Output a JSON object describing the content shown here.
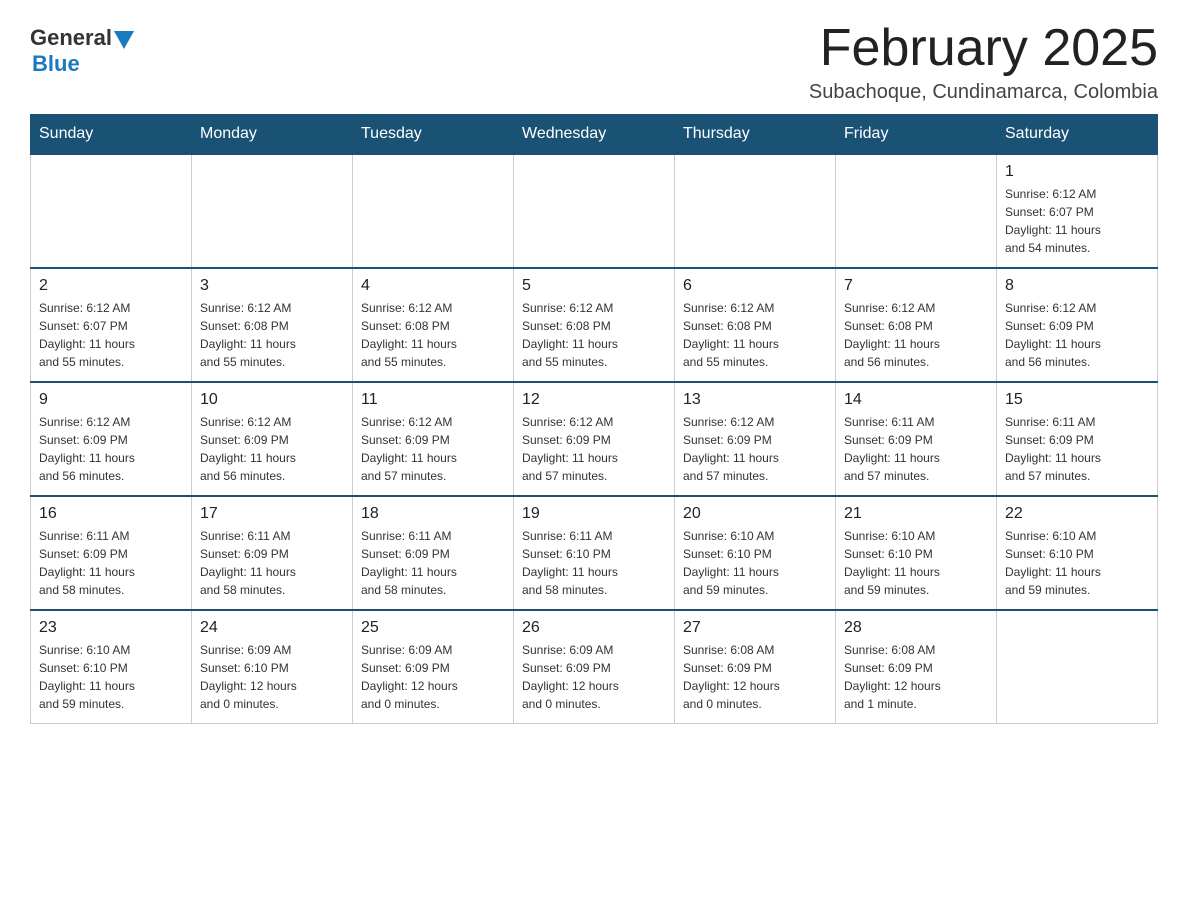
{
  "header": {
    "logo": {
      "general": "General",
      "blue": "Blue"
    },
    "title": "February 2025",
    "subtitle": "Subachoque, Cundinamarca, Colombia"
  },
  "days_of_week": [
    "Sunday",
    "Monday",
    "Tuesday",
    "Wednesday",
    "Thursday",
    "Friday",
    "Saturday"
  ],
  "weeks": [
    {
      "days": [
        {
          "number": "",
          "info": "",
          "empty": true
        },
        {
          "number": "",
          "info": "",
          "empty": true
        },
        {
          "number": "",
          "info": "",
          "empty": true
        },
        {
          "number": "",
          "info": "",
          "empty": true
        },
        {
          "number": "",
          "info": "",
          "empty": true
        },
        {
          "number": "",
          "info": "",
          "empty": true
        },
        {
          "number": "1",
          "info": "Sunrise: 6:12 AM\nSunset: 6:07 PM\nDaylight: 11 hours\nand 54 minutes."
        }
      ]
    },
    {
      "days": [
        {
          "number": "2",
          "info": "Sunrise: 6:12 AM\nSunset: 6:07 PM\nDaylight: 11 hours\nand 55 minutes."
        },
        {
          "number": "3",
          "info": "Sunrise: 6:12 AM\nSunset: 6:08 PM\nDaylight: 11 hours\nand 55 minutes."
        },
        {
          "number": "4",
          "info": "Sunrise: 6:12 AM\nSunset: 6:08 PM\nDaylight: 11 hours\nand 55 minutes."
        },
        {
          "number": "5",
          "info": "Sunrise: 6:12 AM\nSunset: 6:08 PM\nDaylight: 11 hours\nand 55 minutes."
        },
        {
          "number": "6",
          "info": "Sunrise: 6:12 AM\nSunset: 6:08 PM\nDaylight: 11 hours\nand 55 minutes."
        },
        {
          "number": "7",
          "info": "Sunrise: 6:12 AM\nSunset: 6:08 PM\nDaylight: 11 hours\nand 56 minutes."
        },
        {
          "number": "8",
          "info": "Sunrise: 6:12 AM\nSunset: 6:09 PM\nDaylight: 11 hours\nand 56 minutes."
        }
      ]
    },
    {
      "days": [
        {
          "number": "9",
          "info": "Sunrise: 6:12 AM\nSunset: 6:09 PM\nDaylight: 11 hours\nand 56 minutes."
        },
        {
          "number": "10",
          "info": "Sunrise: 6:12 AM\nSunset: 6:09 PM\nDaylight: 11 hours\nand 56 minutes."
        },
        {
          "number": "11",
          "info": "Sunrise: 6:12 AM\nSunset: 6:09 PM\nDaylight: 11 hours\nand 57 minutes."
        },
        {
          "number": "12",
          "info": "Sunrise: 6:12 AM\nSunset: 6:09 PM\nDaylight: 11 hours\nand 57 minutes."
        },
        {
          "number": "13",
          "info": "Sunrise: 6:12 AM\nSunset: 6:09 PM\nDaylight: 11 hours\nand 57 minutes."
        },
        {
          "number": "14",
          "info": "Sunrise: 6:11 AM\nSunset: 6:09 PM\nDaylight: 11 hours\nand 57 minutes."
        },
        {
          "number": "15",
          "info": "Sunrise: 6:11 AM\nSunset: 6:09 PM\nDaylight: 11 hours\nand 57 minutes."
        }
      ]
    },
    {
      "days": [
        {
          "number": "16",
          "info": "Sunrise: 6:11 AM\nSunset: 6:09 PM\nDaylight: 11 hours\nand 58 minutes."
        },
        {
          "number": "17",
          "info": "Sunrise: 6:11 AM\nSunset: 6:09 PM\nDaylight: 11 hours\nand 58 minutes."
        },
        {
          "number": "18",
          "info": "Sunrise: 6:11 AM\nSunset: 6:09 PM\nDaylight: 11 hours\nand 58 minutes."
        },
        {
          "number": "19",
          "info": "Sunrise: 6:11 AM\nSunset: 6:10 PM\nDaylight: 11 hours\nand 58 minutes."
        },
        {
          "number": "20",
          "info": "Sunrise: 6:10 AM\nSunset: 6:10 PM\nDaylight: 11 hours\nand 59 minutes."
        },
        {
          "number": "21",
          "info": "Sunrise: 6:10 AM\nSunset: 6:10 PM\nDaylight: 11 hours\nand 59 minutes."
        },
        {
          "number": "22",
          "info": "Sunrise: 6:10 AM\nSunset: 6:10 PM\nDaylight: 11 hours\nand 59 minutes."
        }
      ]
    },
    {
      "days": [
        {
          "number": "23",
          "info": "Sunrise: 6:10 AM\nSunset: 6:10 PM\nDaylight: 11 hours\nand 59 minutes."
        },
        {
          "number": "24",
          "info": "Sunrise: 6:09 AM\nSunset: 6:10 PM\nDaylight: 12 hours\nand 0 minutes."
        },
        {
          "number": "25",
          "info": "Sunrise: 6:09 AM\nSunset: 6:09 PM\nDaylight: 12 hours\nand 0 minutes."
        },
        {
          "number": "26",
          "info": "Sunrise: 6:09 AM\nSunset: 6:09 PM\nDaylight: 12 hours\nand 0 minutes."
        },
        {
          "number": "27",
          "info": "Sunrise: 6:08 AM\nSunset: 6:09 PM\nDaylight: 12 hours\nand 0 minutes."
        },
        {
          "number": "28",
          "info": "Sunrise: 6:08 AM\nSunset: 6:09 PM\nDaylight: 12 hours\nand 1 minute."
        },
        {
          "number": "",
          "info": "",
          "empty": true
        }
      ]
    }
  ]
}
